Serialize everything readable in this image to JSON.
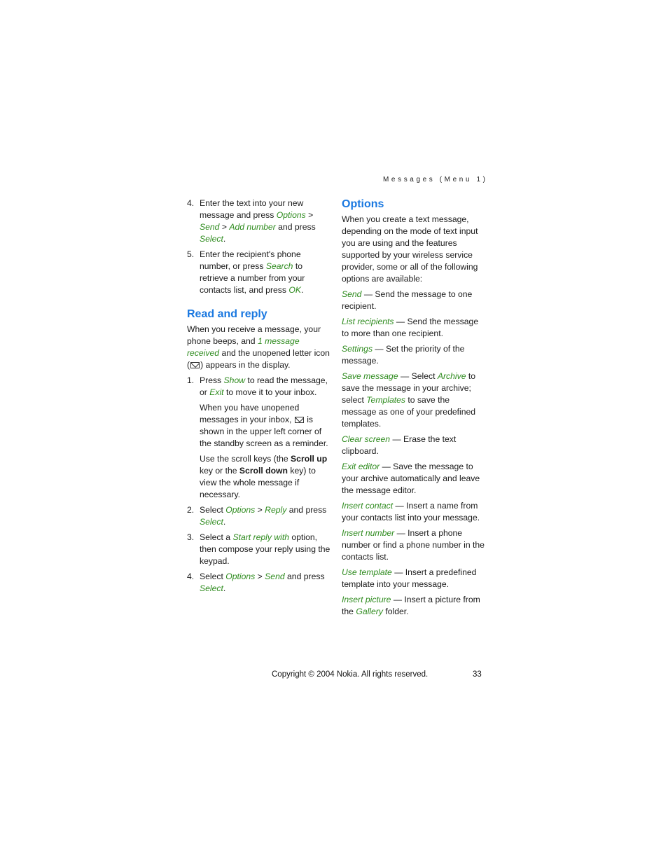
{
  "running_head": "Messages (Menu 1)",
  "left": {
    "steps_top": [
      {
        "num": "4.",
        "parts": [
          "Enter the text into your new message and press ",
          {
            "g": "Options"
          },
          " > ",
          {
            "g": "Send"
          },
          " > ",
          {
            "g": "Add number"
          },
          " and press ",
          {
            "g": "Select"
          },
          "."
        ]
      },
      {
        "num": "5.",
        "parts": [
          "Enter the recipient's phone number, or press ",
          {
            "g": "Search"
          },
          " to retrieve a number from your contacts list, and press ",
          {
            "g": "OK"
          },
          "."
        ]
      }
    ],
    "heading": "Read and reply",
    "intro": [
      "When you receive a message, your phone beeps, and ",
      {
        "g": "1 message received"
      },
      " and the unopened letter icon (",
      {
        "icon": "mail"
      },
      ") appears in the display."
    ],
    "steps": [
      {
        "num": "1.",
        "parts": [
          "Press ",
          {
            "g": "Show"
          },
          " to read the message, or ",
          {
            "g": "Exit"
          },
          " to move it to your inbox."
        ],
        "subs": [
          [
            "When you have unopened messages in your inbox, ",
            {
              "icon": "mail"
            },
            " is shown in the upper left corner of the standby screen as a reminder."
          ],
          [
            "Use the scroll keys (the ",
            {
              "b": "Scroll up"
            },
            " key or the ",
            {
              "b": "Scroll down"
            },
            " key) to view the whole message if necessary."
          ]
        ]
      },
      {
        "num": "2.",
        "parts": [
          "Select ",
          {
            "g": "Options"
          },
          " > ",
          {
            "g": "Reply"
          },
          " and press ",
          {
            "g": "Select"
          },
          "."
        ]
      },
      {
        "num": "3.",
        "parts": [
          "Select a ",
          {
            "g": "Start reply with"
          },
          " option, then compose your reply using the keypad."
        ]
      },
      {
        "num": "4.",
        "parts": [
          "Select ",
          {
            "g": "Options"
          },
          " > ",
          {
            "g": "Send"
          },
          " and press ",
          {
            "g": "Select"
          },
          "."
        ]
      }
    ]
  },
  "right": {
    "heading": "Options",
    "intro": "When you create a text message, depending on the mode of text input you are using and the features supported by your wireless service provider, some or all of the following options are available:",
    "options": [
      [
        "",
        {
          "g": "Send"
        },
        " — Send the message to one recipient."
      ],
      [
        "",
        {
          "g": "List recipients"
        },
        " — Send the message to more than one recipient."
      ],
      [
        "",
        {
          "g": "Settings"
        },
        " — Set the priority of the message."
      ],
      [
        "",
        {
          "g": "Save message"
        },
        " — Select ",
        {
          "g": "Archive"
        },
        " to save the message in your archive; select ",
        {
          "g": "Templates"
        },
        " to save the message as one of your predefined templates."
      ],
      [
        "",
        {
          "g": "Clear screen"
        },
        " — Erase the text clipboard."
      ],
      [
        "",
        {
          "g": "Exit editor"
        },
        " — Save the message to your archive automatically and leave the message editor."
      ],
      [
        "",
        {
          "g": "Insert contact"
        },
        " — Insert a name from your contacts list into your message."
      ],
      [
        "",
        {
          "g": "Insert number"
        },
        " — Insert a phone number or find a phone number in the contacts list."
      ],
      [
        "",
        {
          "g": "Use template"
        },
        " — Insert a predefined template into your message."
      ],
      [
        "",
        {
          "g": "Insert picture"
        },
        " — Insert a picture from the ",
        {
          "g": "Gallery"
        },
        " folder."
      ]
    ]
  },
  "footer": {
    "copyright": "Copyright © 2004 Nokia. All rights reserved.",
    "page_number": "33"
  },
  "colors": {
    "heading": "#1a78e0",
    "menu_term": "#2e8b1e"
  }
}
